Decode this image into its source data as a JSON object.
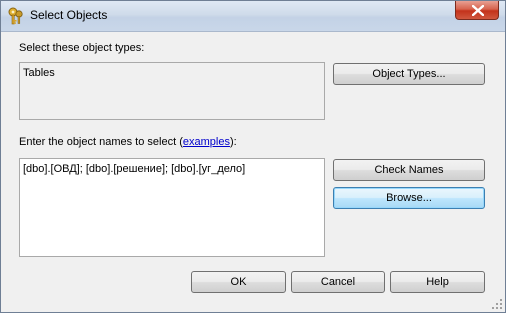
{
  "window": {
    "title": "Select Objects"
  },
  "object_types": {
    "label": "Select these object types:",
    "value": "Tables",
    "button": "Object Types..."
  },
  "object_names": {
    "label_prefix": "Enter the object names to select (",
    "link": "examples",
    "label_suffix": "):",
    "value": "[dbo].[ОВД]; [dbo].[решение]; [dbo].[уг_дело]"
  },
  "buttons": {
    "check_names": "Check Names",
    "browse": "Browse...",
    "ok": "OK",
    "cancel": "Cancel",
    "help": "Help"
  }
}
